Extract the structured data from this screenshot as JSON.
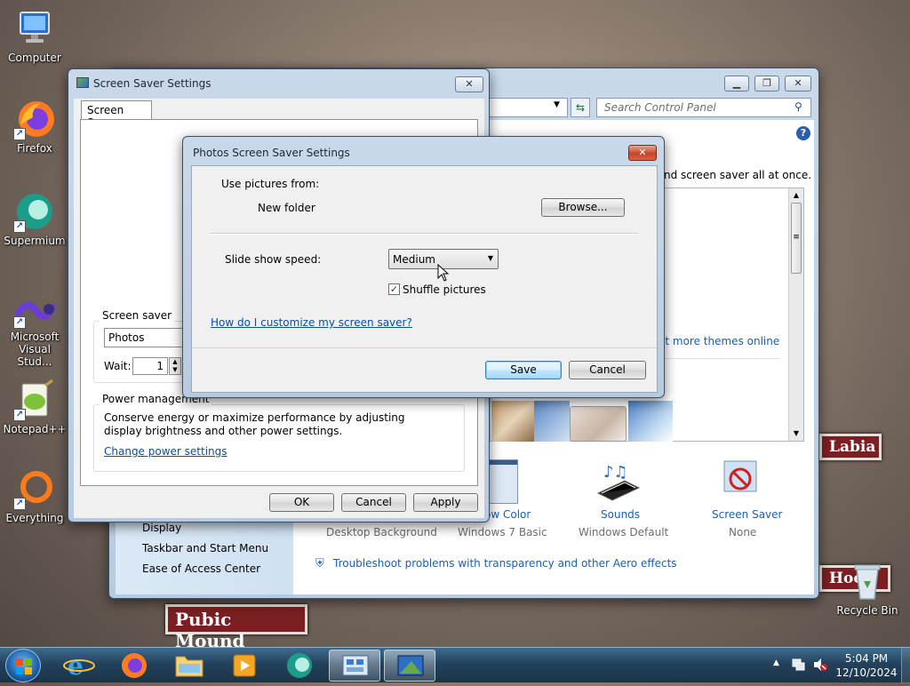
{
  "desktop": {
    "icons": [
      {
        "label": "Computer"
      },
      {
        "label": "Firefox"
      },
      {
        "label": "Supermium"
      },
      {
        "label": "Microsoft Visual Stud..."
      },
      {
        "label": "Notepad++"
      },
      {
        "label": "Everything"
      },
      {
        "label": "Recycle Bin"
      }
    ],
    "wallpaper_signs": [
      "Labia",
      "Pubic Mound",
      "Hood"
    ]
  },
  "control_panel": {
    "search_placeholder": "Search Control Panel",
    "intro_text": "nd screen saver all at once.",
    "more_themes_link": "et more themes online",
    "tiles": [
      {
        "title": "ow Color",
        "subtitle": "Windows 7 Basic"
      },
      {
        "title": "Sounds",
        "subtitle": "Windows Default"
      },
      {
        "title": "Screen Saver",
        "subtitle": "None"
      }
    ],
    "desktop_background_label": "Desktop Background",
    "troubleshoot_link": "Troubleshoot problems with transparency and other Aero effects",
    "sidebar_links": [
      "Display",
      "Taskbar and Start Menu",
      "Ease of Access Center"
    ]
  },
  "screen_saver_window": {
    "title": "Screen Saver Settings",
    "tab": "Screen Saver",
    "group_label": "Screen saver",
    "saver_value": "Photos",
    "wait_label": "Wait:",
    "wait_value": "1",
    "power_label": "Power management",
    "power_text": "Conserve energy or maximize performance by adjusting display brightness and other power settings.",
    "power_link": "Change power settings",
    "ok": "OK",
    "cancel": "Cancel",
    "apply": "Apply"
  },
  "photos_dialog": {
    "title": "Photos Screen Saver Settings",
    "use_pictures_label": "Use pictures from:",
    "folder": "New folder",
    "browse": "Browse...",
    "speed_label": "Slide show speed:",
    "speed_value": "Medium",
    "shuffle_label": "Shuffle pictures",
    "shuffle_checked": true,
    "help_link": "How do I customize my screen saver?",
    "save": "Save",
    "cancel": "Cancel"
  },
  "taskbar": {
    "apps": [
      "Internet Explorer",
      "Firefox",
      "Windows Explorer",
      "Media Player",
      "Supermium",
      "Control Panel",
      "Screen Saver Settings"
    ],
    "time": "5:04 PM",
    "date": "12/10/2024"
  },
  "colors": {
    "link": "#0a4ea8",
    "taskbar": "#23425d",
    "close": "#c7432a"
  }
}
